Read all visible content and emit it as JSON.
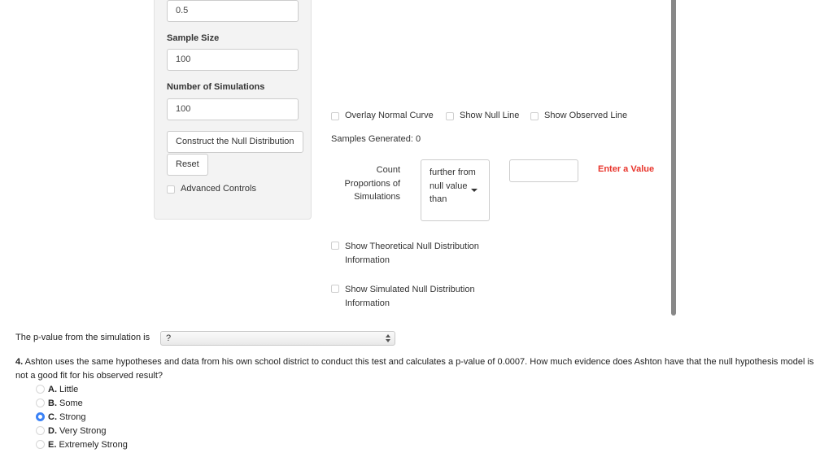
{
  "sidebar": {
    "first_input_value": "0.5",
    "sample_size_label": "Sample Size",
    "sample_size_value": "100",
    "num_simulations_label": "Number of Simulations",
    "num_simulations_value": "100",
    "construct_button": "Construct the Null Distribution",
    "reset_button": "Reset",
    "advanced_controls_label": "Advanced Controls",
    "advanced_controls_checked": false
  },
  "main": {
    "checkboxes": [
      {
        "label": "Overlay Normal Curve",
        "checked": false
      },
      {
        "label": "Show Null Line",
        "checked": false
      },
      {
        "label": "Show Observed Line",
        "checked": false
      }
    ],
    "samples_generated": "Samples Generated: 0",
    "count_label_lines": [
      "Count",
      "Proportions of",
      "Simulations"
    ],
    "direction_select_lines": [
      "further from",
      "null value",
      "than"
    ],
    "value_input": "",
    "warning": "Enter a Value",
    "warning_color": "#e8352c",
    "theoretical_info": {
      "lines": [
        "Show Theoretical Null Distribution",
        "Information"
      ],
      "checked": false
    },
    "simulated_info": {
      "lines": [
        "Show Simulated Null Distribution",
        "Information"
      ],
      "checked": false
    }
  },
  "pvalue": {
    "label": "The p-value from the simulation is",
    "selected": "?"
  },
  "question": {
    "number": "4.",
    "text": " Ashton uses the same hypotheses and data from his own school district to conduct this test and calculates a p-value of 0.0007. How much evidence does Ashton have that the null hypothesis model is not a good fit for his observed result?",
    "options": [
      {
        "letter": "A.",
        "text": " Little",
        "checked": false
      },
      {
        "letter": "B.",
        "text": " Some",
        "checked": false
      },
      {
        "letter": "C.",
        "text": " Strong",
        "checked": true
      },
      {
        "letter": "D.",
        "text": " Very Strong",
        "checked": false
      },
      {
        "letter": "E.",
        "text": " Extremely Strong",
        "checked": false
      }
    ],
    "accent_color": "#3b82f6"
  }
}
